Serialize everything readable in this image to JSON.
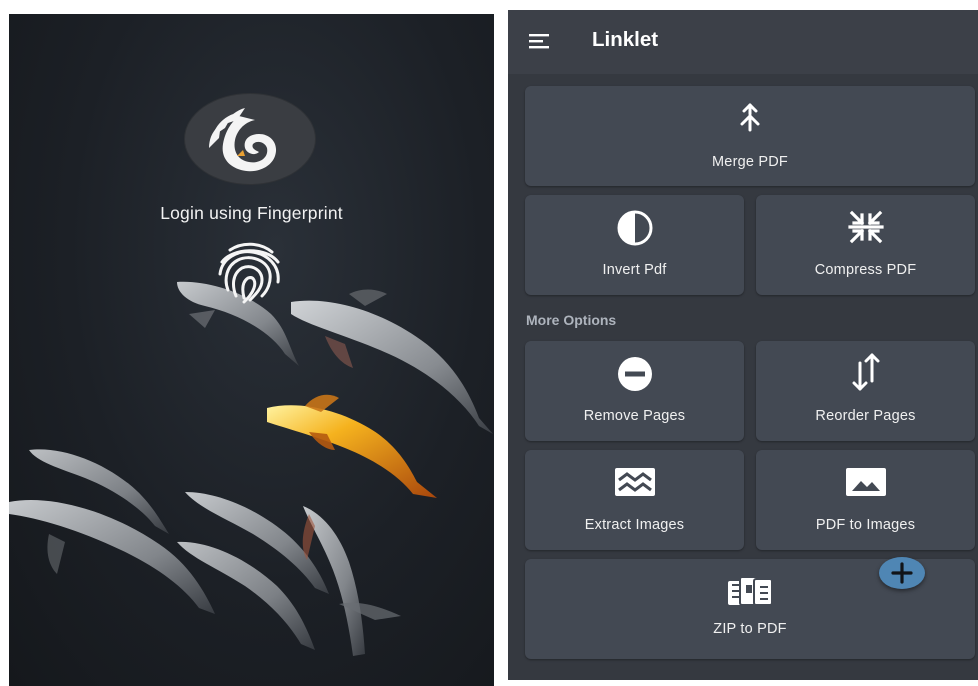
{
  "login": {
    "title": "Login using Fingerprint",
    "logo_icon": "swan-logo-icon",
    "fingerprint_icon": "fingerprint-icon"
  },
  "app": {
    "title": "Linklet",
    "menu_icon": "hamburger-menu-icon",
    "section_label": "More Options",
    "fab_icon": "plus-icon",
    "cards": [
      {
        "label": "Merge PDF",
        "icon": "merge-icon"
      },
      {
        "label": "Invert Pdf",
        "icon": "invert-contrast-icon"
      },
      {
        "label": "Compress PDF",
        "icon": "compress-icon"
      },
      {
        "label": "Remove Pages",
        "icon": "remove-circle-icon"
      },
      {
        "label": "Reorder Pages",
        "icon": "swap-vertical-icon"
      },
      {
        "label": "Extract Images",
        "icon": "broken-image-icon"
      },
      {
        "label": "PDF to Images",
        "icon": "image-icon"
      },
      {
        "label": "ZIP to PDF",
        "icon": "zip-archive-icon"
      }
    ]
  },
  "colors": {
    "app_background": "#36393e",
    "card_background": "#434953",
    "fab": "#4f86b4",
    "koi_accent": "#f0a020"
  }
}
